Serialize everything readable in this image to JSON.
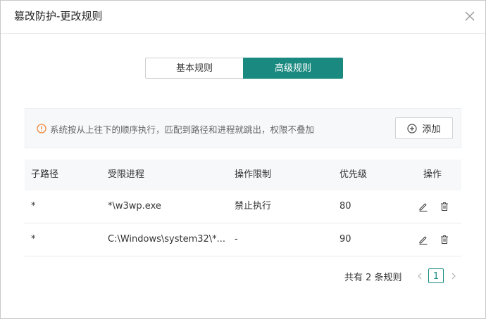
{
  "dialog": {
    "title": "篡改防护-更改规则"
  },
  "tabs": [
    {
      "label": "基本规则",
      "active": false
    },
    {
      "label": "高级规则",
      "active": true
    }
  ],
  "notice": {
    "text": "系统按从上往下的顺序执行，匹配到路径和进程就跳出，权限不叠加",
    "add_label": "添加"
  },
  "table": {
    "columns": [
      "子路径",
      "受限进程",
      "操作限制",
      "优先级",
      "操作"
    ],
    "rows": [
      {
        "path": "*",
        "process": "*\\w3wp.exe",
        "restriction": "禁止执行",
        "priority": "80"
      },
      {
        "path": "*",
        "process": "C:\\Windows\\system32\\*...",
        "restriction": "-",
        "priority": "90"
      }
    ]
  },
  "pagination": {
    "total_text": "共有 2 条规则",
    "current_page": "1"
  },
  "colors": {
    "accent": "#1a8a80",
    "warning": "#f0883a"
  },
  "icons": {
    "close": "close-icon",
    "warning": "warning-circle-icon",
    "add": "plus-circle-icon",
    "edit": "pencil-icon",
    "delete": "trash-icon",
    "prev": "chevron-left-icon",
    "next": "chevron-right-icon"
  }
}
